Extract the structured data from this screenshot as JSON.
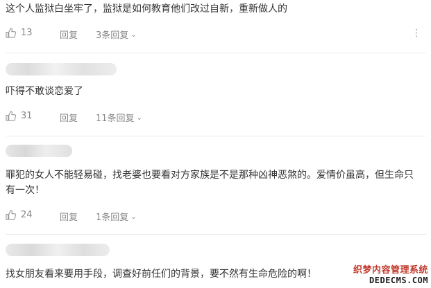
{
  "comments": [
    {
      "text": "这个人监狱白坐牢了，监狱是如何教育他们改过自新，重新做人的",
      "likes": "13",
      "reply_label": "回复",
      "sub_replies": "3条回复"
    },
    {
      "text": "吓得不敢谈恋爱了",
      "likes": "31",
      "reply_label": "回复",
      "sub_replies": "11条回复"
    },
    {
      "text": "罪犯的女人不能轻易碰，找老婆也要看对方家族是不是那种凶神恶煞的。爱情价虽高，但生命只有一次！",
      "likes": "24",
      "reply_label": "回复",
      "sub_replies": "1条回复"
    },
    {
      "text": "找女朋友看来要用手段，调查好前任们的背景，要不然有生命危险的啊！"
    }
  ],
  "more_icon": "vertical-ellipsis",
  "like_icon": "thumbs-up",
  "watermark": {
    "line1": "织梦内容管理系统",
    "line2": "DEDECMS.COM"
  },
  "colors": {
    "text": "#333333",
    "muted": "#888888",
    "separator": "#ebebeb"
  }
}
